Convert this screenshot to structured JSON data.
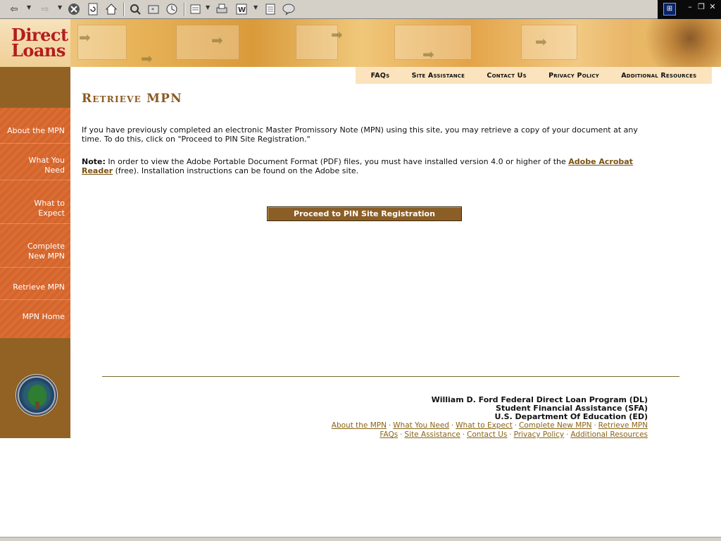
{
  "browser": {
    "toolbar_icons": [
      "back-icon",
      "forward-icon",
      "stop-icon",
      "refresh-icon",
      "home-icon",
      "search-icon",
      "favorites-icon",
      "history-icon",
      "mail-icon",
      "print-icon",
      "edit-icon",
      "discuss-icon",
      "messenger-icon"
    ]
  },
  "banner": {
    "logo_line1": "Direct",
    "logo_line2": "Loans"
  },
  "topnav": {
    "items": [
      "FAQs",
      "Site Assistance",
      "Contact Us",
      "Privacy Policy",
      "Additional Resources"
    ]
  },
  "sidebar": {
    "items": [
      {
        "line1": "About the MPN",
        "line2": ""
      },
      {
        "line1": "What You",
        "line2": "Need"
      },
      {
        "line1": "What to",
        "line2": "Expect"
      },
      {
        "line1": "Complete",
        "line2": "New MPN"
      },
      {
        "line1": "Retrieve MPN",
        "line2": ""
      },
      {
        "line1": "MPN Home",
        "line2": ""
      }
    ]
  },
  "main": {
    "title": "Retrieve MPN",
    "intro": "If you have previously completed an electronic Master Promissory Note (MPN) using this site, you may retrieve a copy of your document at any time. To do this, click on \"Proceed to PIN Site Registration.\"",
    "note_label": "Note:",
    "note_text": " In order to view the Adobe Portable Document Format (PDF) files, you must have installed version 4.0 or higher of the ",
    "note_link": "Adobe Acrobat Reader",
    "note_after": " (free). Installation instructions can be found on the Adobe site.",
    "proceed_button": "Proceed to PIN Site Registration"
  },
  "footer": {
    "line1": "William D. Ford Federal Direct Loan Program (DL)",
    "line2": "Student Financial Assistance (SFA)",
    "line3": "U.S. Department Of Education (ED)",
    "links_row1": [
      "About the MPN",
      "What You Need",
      "What to Expect",
      "Complete New MPN",
      "Retrieve MPN"
    ],
    "links_row2": [
      "FAQs",
      "Site Assistance",
      "Contact Us",
      "Privacy Policy",
      "Additional Resources"
    ],
    "separator": "·"
  },
  "colors": {
    "accent_brown": "#8a5a22",
    "sidebar_orange": "#d4652c",
    "sidebar_brown": "#926124",
    "logo_red": "#b51d1d"
  }
}
